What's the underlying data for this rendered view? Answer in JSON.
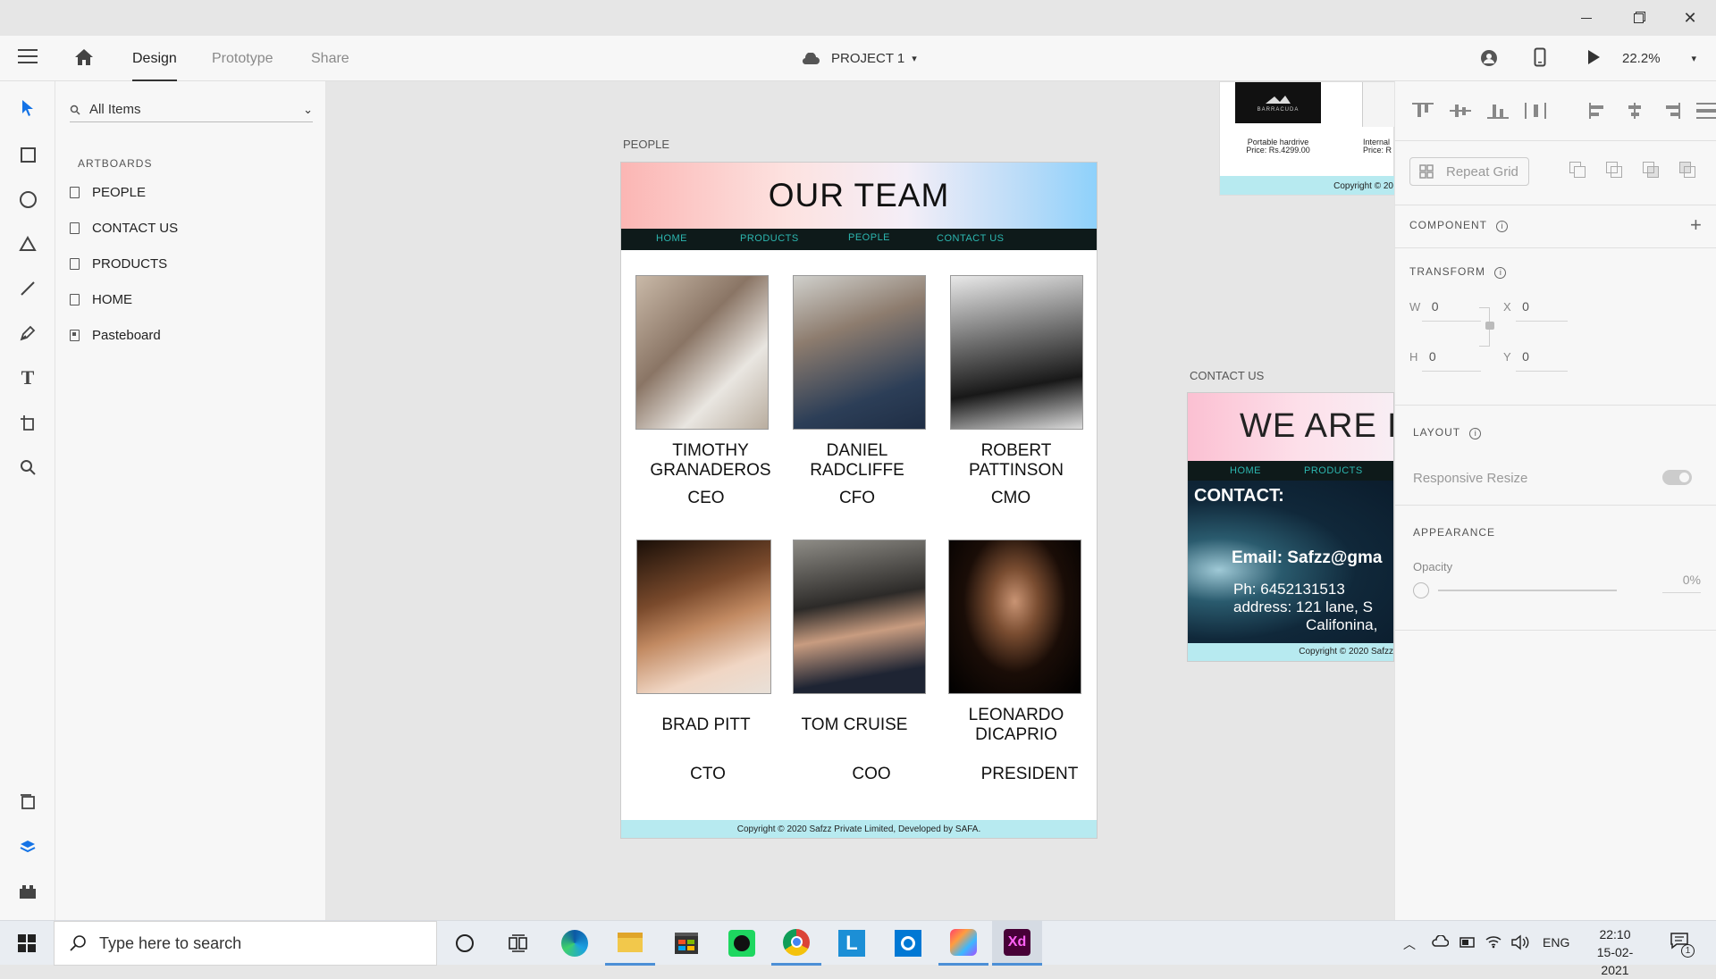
{
  "window": {
    "controls": [
      "minimize",
      "restore",
      "close"
    ]
  },
  "appbar": {
    "tabs": [
      {
        "label": "Design"
      },
      {
        "label": "Prototype"
      },
      {
        "label": "Share"
      }
    ],
    "project_label": "PROJECT 1",
    "zoom": "22.2%"
  },
  "layers": {
    "search_placeholder": "All Items",
    "section_label": "ARTBOARDS",
    "items": [
      {
        "label": "PEOPLE"
      },
      {
        "label": "CONTACT US"
      },
      {
        "label": "PRODUCTS"
      },
      {
        "label": "HOME"
      },
      {
        "label": "Pasteboard"
      }
    ]
  },
  "canvas": {
    "people": {
      "artboard_label": "PEOPLE",
      "heading": "OUR TEAM",
      "nav": [
        "HOME",
        "PRODUCTS",
        "PEOPLE",
        "CONTACT US"
      ],
      "members": [
        {
          "name": "TIMOTHY GRANADEROS",
          "role": "CEO"
        },
        {
          "name": "DANIEL RADCLIFFE",
          "role": "CFO"
        },
        {
          "name": "ROBERT PATTINSON",
          "role": "CMO"
        },
        {
          "name": "BRAD PITT",
          "role": "CTO"
        },
        {
          "name": "TOM CRUISE",
          "role": "COO"
        },
        {
          "name": "LEONARDO DICAPRIO",
          "role": "PRESIDENT"
        }
      ],
      "footer": "Copyright © 2020 Safzz Private Limited, Developed by SAFA."
    },
    "products": {
      "brand": "BARRACUDA",
      "item1_name": "Portable hardrive",
      "item1_price": "Price: Rs.4299.00",
      "item2_name": "Internal",
      "item2_price": "Price: R",
      "footer": "Copyright © 20"
    },
    "contact": {
      "artboard_label": "CONTACT US",
      "heading": "WE ARE H",
      "nav": [
        "HOME",
        "PRODUCTS"
      ],
      "contact_title": "CONTACT:",
      "email": "Email: Safzz@gma",
      "phone": "Ph: 6452131513",
      "address": "address: 121 lane, S",
      "city": "Califonina,",
      "footer": "Copyright © 2020 Safzz"
    }
  },
  "props": {
    "repeat_grid": "Repeat Grid",
    "component": "COMPONENT",
    "transform": "TRANSFORM",
    "w_label": "W",
    "w": "0",
    "x_label": "X",
    "x": "0",
    "h_label": "H",
    "h": "0",
    "y_label": "Y",
    "y": "0",
    "layout": "LAYOUT",
    "responsive_resize": "Responsive Resize",
    "appearance": "APPEARANCE",
    "opacity_label": "Opacity",
    "opacity": "0%"
  },
  "taskbar": {
    "search_placeholder": "Type here to search",
    "lang": "ENG",
    "time": "22:10",
    "date": "15-02-2021",
    "notification_count": "1",
    "apps": [
      "cortana",
      "task-view",
      "edge",
      "file-explorer",
      "store",
      "spotify",
      "chrome",
      "l-app",
      "circle-app",
      "creative-cloud",
      "adobe-xd"
    ]
  },
  "colors": {
    "accent": "#1473e6",
    "xd": "#ff61f6",
    "nav_bg": "#0e1a1a",
    "nav_text": "#2cb7b0",
    "footer_bg": "#b7eaf0"
  }
}
